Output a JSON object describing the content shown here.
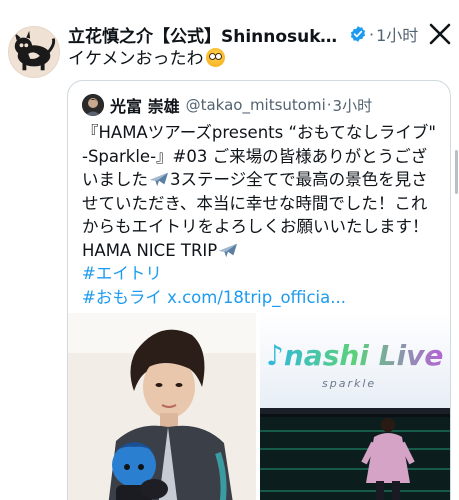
{
  "post": {
    "author": {
      "display_name": "立花慎之介【公式】Shinnosuke Ta...",
      "verified": true,
      "avatar_icon": "black-cat-lion-illustration-icon"
    },
    "separator": "·",
    "time": "1小时",
    "text": "イケメンおったわ",
    "emoji": "flushed-face-emoji",
    "close_icon": "x-logo-icon"
  },
  "quote": {
    "author": {
      "name": "光富 崇雄",
      "handle": "@takao_mitsutomi",
      "time": "3小时"
    },
    "separator": "·",
    "lines": [
      "『HAMAツアーズpresents “おもてなしライブ\"",
      "-Sparkle-』#03 ご来場の皆様ありがとうござ",
      "いました",
      "3ステージ全てで最高の景色を見さ",
      "せていただき、本当に幸せな時間でした！これ",
      "からもエイトリをよろしくお願いいたします！",
      "HAMA NICE TRIP"
    ],
    "hashtags": [
      "#エイトリ",
      "#おもライ"
    ],
    "link": "x.com/18trip_officia...",
    "emoji": "airplane-emoji",
    "media": [
      {
        "icon": "man-with-plush-doll-photo"
      },
      {
        "icon": "stage-sparkle-live-photo",
        "stage_text": "おもてなしLive",
        "stage_subtext": "sparkle"
      }
    ]
  },
  "colors": {
    "text": "#0f1419",
    "secondary": "#536471",
    "link": "#1d9bf0",
    "border": "#cfd9de"
  }
}
